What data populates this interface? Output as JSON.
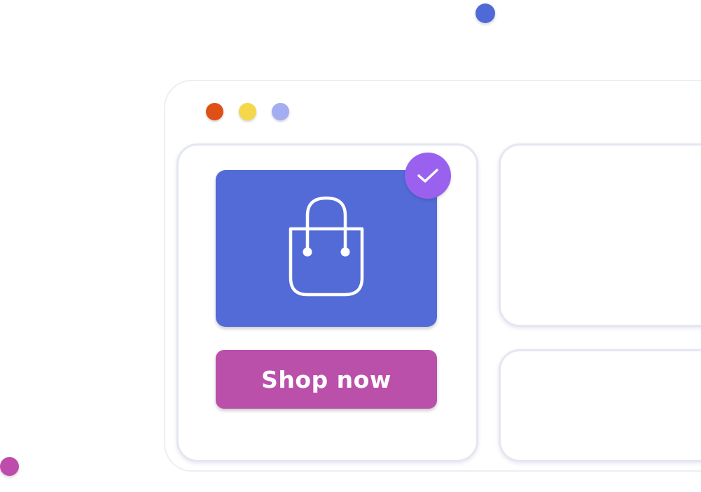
{
  "colors": {
    "background": "#ffffff",
    "window_border": "#eceef5",
    "card_border": "#e4e7f2",
    "product_image_bg": "#536bd7",
    "shop_button_bg": "#bb50aa",
    "check_badge_bg": "#9a61ef",
    "control_close": "#de5016",
    "control_minimize": "#f4d84a",
    "control_maximize": "#a2aef1",
    "decor_dot_top": "#4f69d6",
    "decor_dot_bottom": "#be4cac"
  },
  "icons": {
    "product": "shopping-bag-icon",
    "badge": "checkmark-icon"
  },
  "product_card": {
    "button_label": "Shop now"
  }
}
